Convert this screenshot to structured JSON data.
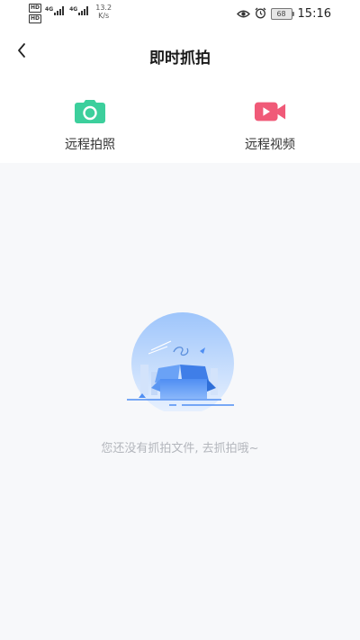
{
  "status_bar": {
    "hd1": "HD",
    "hd2": "HD",
    "net1": "4G",
    "net2": "4G",
    "speed_value": "13.2",
    "speed_unit": "K/s",
    "battery": "68",
    "time": "15:16"
  },
  "header": {
    "title": "即时抓拍"
  },
  "actions": [
    {
      "label": "远程拍照",
      "icon": "camera-icon",
      "color": "#3ccf9c"
    },
    {
      "label": "远程视频",
      "icon": "video-camera-icon",
      "color": "#f05a78"
    }
  ],
  "empty_state": {
    "message": "您还没有抓拍文件, 去抓拍哦~",
    "icon": "empty-box-icon"
  }
}
